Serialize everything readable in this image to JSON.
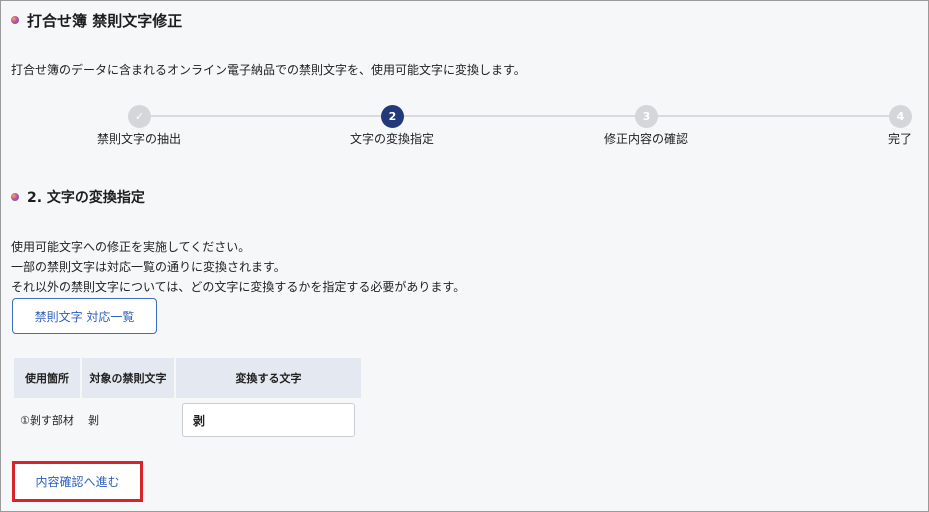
{
  "page": {
    "title": "打合せ簿 禁則文字修正",
    "intro": "打合せ簿のデータに含まれるオンライン電子納品での禁則文字を、使用可能文字に変換します。"
  },
  "stepper": {
    "steps": [
      {
        "number": "✓",
        "label": "禁則文字の抽出",
        "state": "done"
      },
      {
        "number": "2",
        "label": "文字の変換指定",
        "state": "current"
      },
      {
        "number": "3",
        "label": "修正内容の確認",
        "state": "todo"
      },
      {
        "number": "4",
        "label": "完了",
        "state": "todo"
      }
    ]
  },
  "section": {
    "title": "2. 文字の変換指定",
    "desc_lines": [
      "使用可能文字への修正を実施してください。",
      "一部の禁則文字は対応一覧の通りに変換されます。",
      "それ以外の禁則文字については、どの文字に変換するかを指定する必要があります。"
    ],
    "list_button": "禁則文字 対応一覧"
  },
  "table": {
    "headers": [
      "使用箇所",
      "対象の禁則文字",
      "変換する文字"
    ],
    "rows": [
      {
        "location": "①剝す部材",
        "char": "剝",
        "converted": "剥"
      }
    ]
  },
  "actions": {
    "next_label": "内容確認へ進む"
  },
  "colors": {
    "accent": "#2d5fbf",
    "step_current": "#233a7a",
    "highlight": "#d9232a"
  }
}
